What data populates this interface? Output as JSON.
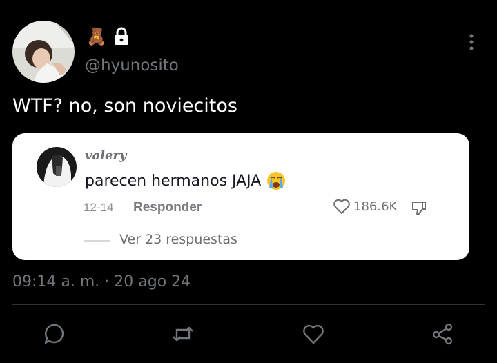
{
  "tweet": {
    "author_emoji": "🧸",
    "handle": "@hyunosito",
    "text": "WTF? no, son noviecitos",
    "timestamp": "09:14 a. m. · 20 ago 24"
  },
  "quoted_comment": {
    "username": "valery",
    "text": "parecen hermanos JAJA",
    "date": "12-14",
    "reply_label": "Responder",
    "likes": "186.6K",
    "replies_label": "Ver 23 respuestas"
  },
  "icons": {
    "avatar": "avatar-photo",
    "lock": "lock-icon",
    "more": "more-vertical-icon",
    "reply": "reply-icon",
    "retweet": "retweet-icon",
    "like": "heart-icon",
    "share": "share-icon"
  },
  "colors": {
    "background": "#000000",
    "text": "#ffffff",
    "secondary": "#71767b",
    "card": "#ffffff"
  }
}
